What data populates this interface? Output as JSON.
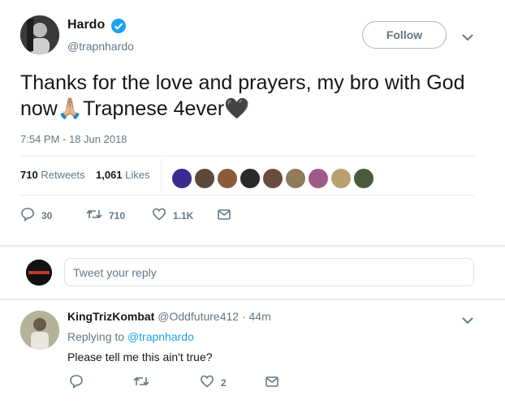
{
  "tweet": {
    "author_name": "Hardo",
    "author_handle": "@trapnhardo",
    "follow_label": "Follow",
    "text": "Thanks for the love and prayers, my bro with God now🙏🏼Trapnese 4ever🖤",
    "timestamp": "7:54 PM - 18 Jun 2018",
    "retweets_count": "710",
    "retweets_label": "Retweets",
    "likes_count": "1,061",
    "likes_label": "Likes",
    "actions": {
      "reply_count": "30",
      "retweet_count": "710",
      "like_count": "1.1K"
    }
  },
  "reply_composer": {
    "placeholder": "Tweet your reply"
  },
  "reply": {
    "author_name": "KingTrizKombat",
    "author_handle": "@Oddfuture412",
    "time": "· 44m",
    "replying_to_label": "Replying to",
    "replying_to_handle": "@trapnhardo",
    "text": "Please tell me this ain't true?",
    "like_count": "2"
  },
  "colors": {
    "accent": "#1da1f2",
    "muted": "#657786",
    "verified": "#1da1f2"
  },
  "icons": [
    "verified-badge-icon",
    "chevron-down-icon",
    "reply-icon",
    "retweet-icon",
    "like-icon",
    "message-icon"
  ]
}
